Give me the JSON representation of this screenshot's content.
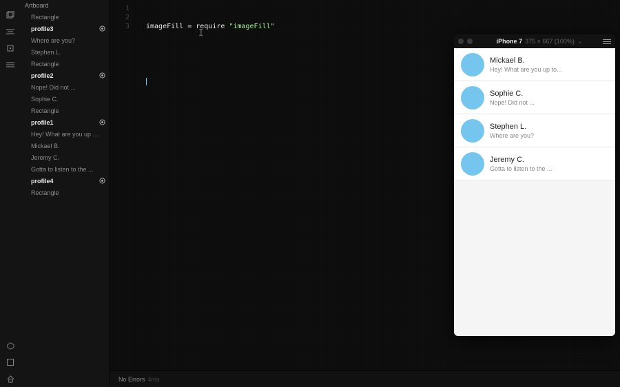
{
  "sidebar": {
    "title": "Artboard",
    "layers": [
      {
        "label": "Rectangle",
        "bold": false,
        "target": false
      },
      {
        "label": "profile3",
        "bold": true,
        "target": true
      },
      {
        "label": "Where are you?",
        "bold": false,
        "target": false
      },
      {
        "label": "Stephen L.",
        "bold": false,
        "target": false
      },
      {
        "label": "Rectangle",
        "bold": false,
        "target": false
      },
      {
        "label": "profile2",
        "bold": true,
        "target": true
      },
      {
        "label": "Nope! Did not ...",
        "bold": false,
        "target": false
      },
      {
        "label": "Sophie C.",
        "bold": false,
        "target": false
      },
      {
        "label": "Rectangle",
        "bold": false,
        "target": false
      },
      {
        "label": "profile1",
        "bold": true,
        "target": true
      },
      {
        "label": "Hey! What are you up to...",
        "bold": false,
        "target": false
      },
      {
        "label": "Mickael B.",
        "bold": false,
        "target": false
      },
      {
        "label": "Jeremy C.",
        "bold": false,
        "target": false
      },
      {
        "label": "Gotta to listen to the ...",
        "bold": false,
        "target": false
      },
      {
        "label": "profile4",
        "bold": true,
        "target": true
      },
      {
        "label": "Rectangle",
        "bold": false,
        "target": false
      }
    ]
  },
  "code": {
    "line1_left": "imageFill",
    "line1_mid": " = require ",
    "line1_string": "\"imageFill\"",
    "line_numbers": [
      "1",
      "2",
      "3"
    ]
  },
  "status": {
    "label": "No Errors",
    "timing": "4ms"
  },
  "preview": {
    "device": "iPhone 7",
    "dims": "375 × 667 (100%)",
    "contacts": [
      {
        "name": "Mickael B.",
        "sub": "Hey! What are you up to..."
      },
      {
        "name": "Sophie C.",
        "sub": "Nope! Did not ..."
      },
      {
        "name": "Stephen L.",
        "sub": "Where are you?"
      },
      {
        "name": "Jeremy C.",
        "sub": "Gotta to listen to the ..."
      }
    ]
  }
}
